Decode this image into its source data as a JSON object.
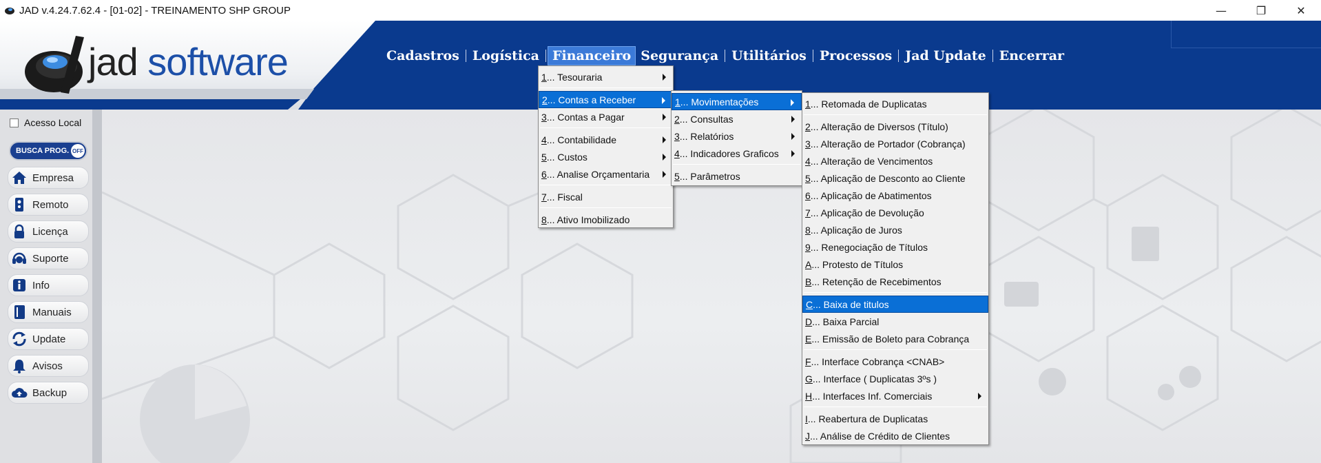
{
  "window": {
    "title": "JAD v.4.24.7.62.4 - [01-02] - TREINAMENTO SHP GROUP",
    "minimize": "—",
    "maximize": "❐",
    "close": "✕"
  },
  "logo": {
    "part1": "jad ",
    "part2": "software"
  },
  "mainmenu": [
    {
      "label": "Cadastros"
    },
    {
      "label": "Logística"
    },
    {
      "label": "Financeiro",
      "active": true
    },
    {
      "label": "Segurança"
    },
    {
      "label": "Utilitários"
    },
    {
      "label": "Processos"
    },
    {
      "label": "Jad Update"
    },
    {
      "label": "Encerrar"
    }
  ],
  "sidebar": {
    "acesso_local": "Acesso Local",
    "busca": "BUSCA PROG.",
    "busca_state": "OFF",
    "items": [
      {
        "label": "Empresa",
        "icon": "home-icon"
      },
      {
        "label": "Remoto",
        "icon": "remote-icon"
      },
      {
        "label": "Licença",
        "icon": "lock-icon"
      },
      {
        "label": "Suporte",
        "icon": "headset-icon"
      },
      {
        "label": "Info",
        "icon": "info-icon"
      },
      {
        "label": "Manuais",
        "icon": "book-icon"
      },
      {
        "label": "Update",
        "icon": "refresh-icon"
      },
      {
        "label": "Avisos",
        "icon": "bell-icon"
      },
      {
        "label": "Backup",
        "icon": "cloud-upload-icon"
      }
    ]
  },
  "menu_financeiro": [
    {
      "key": "1",
      "label": "... Tesouraria",
      "sub": true
    },
    {
      "sep": true
    },
    {
      "key": "2",
      "label": "... Contas a Receber",
      "sub": true,
      "hl": true
    },
    {
      "key": "3",
      "label": "... Contas a Pagar",
      "sub": true
    },
    {
      "sep": true
    },
    {
      "key": "4",
      "label": "... Contabilidade",
      "sub": true
    },
    {
      "key": "5",
      "label": "... Custos",
      "sub": true
    },
    {
      "key": "6",
      "label": "... Analise Orçamentaria",
      "sub": true
    },
    {
      "sep": true
    },
    {
      "key": "7",
      "label": "... Fiscal"
    },
    {
      "sep": true
    },
    {
      "key": "8",
      "label": "... Ativo Imobilizado"
    }
  ],
  "menu_contas_receber": [
    {
      "key": "1",
      "label": "... Movimentações",
      "sub": true,
      "hl": true
    },
    {
      "key": "2",
      "label": "... Consultas",
      "sub": true
    },
    {
      "key": "3",
      "label": "... Relatórios",
      "sub": true
    },
    {
      "key": "4",
      "label": "... Indicadores Graficos",
      "sub": true
    },
    {
      "sep": true
    },
    {
      "key": "5",
      "label": "... Parâmetros"
    }
  ],
  "menu_movimentacoes": [
    {
      "key": "1",
      "label": "... Retomada de Duplicatas"
    },
    {
      "sep": true
    },
    {
      "key": "2",
      "label": "... Alteração de Diversos (Título)"
    },
    {
      "key": "3",
      "label": "... Alteração de Portador (Cobrança)"
    },
    {
      "key": "4",
      "label": "... Alteração de Vencimentos"
    },
    {
      "key": "5",
      "label": "... Aplicação de Desconto ao Cliente"
    },
    {
      "key": "6",
      "label": "... Aplicação de Abatimentos"
    },
    {
      "key": "7",
      "label": "... Aplicação de Devolução"
    },
    {
      "key": "8",
      "label": "... Aplicação de Juros"
    },
    {
      "key": "9",
      "label": "... Renegociação de Títulos"
    },
    {
      "key": "A",
      "label": "... Protesto de Títulos"
    },
    {
      "key": "B",
      "label": "... Retenção de Recebimentos"
    },
    {
      "sep": true
    },
    {
      "key": "C",
      "label": "... Baixa de titulos",
      "hl": true
    },
    {
      "key": "D",
      "label": "... Baixa Parcial"
    },
    {
      "key": "E",
      "label": "... Emissão de Boleto para Cobrança"
    },
    {
      "sep": true
    },
    {
      "key": "F",
      "label": "... Interface Cobrança <CNAB>"
    },
    {
      "key": "G",
      "label": "... Interface ( Duplicatas 3ºs )"
    },
    {
      "key": "H",
      "label": "... Interfaces Inf. Comerciais",
      "sub": true
    },
    {
      "sep": true
    },
    {
      "key": "I",
      "label": "... Reabertura de Duplicatas"
    },
    {
      "key": "J",
      "label": "... Análise de Crédito de Clientes"
    }
  ]
}
